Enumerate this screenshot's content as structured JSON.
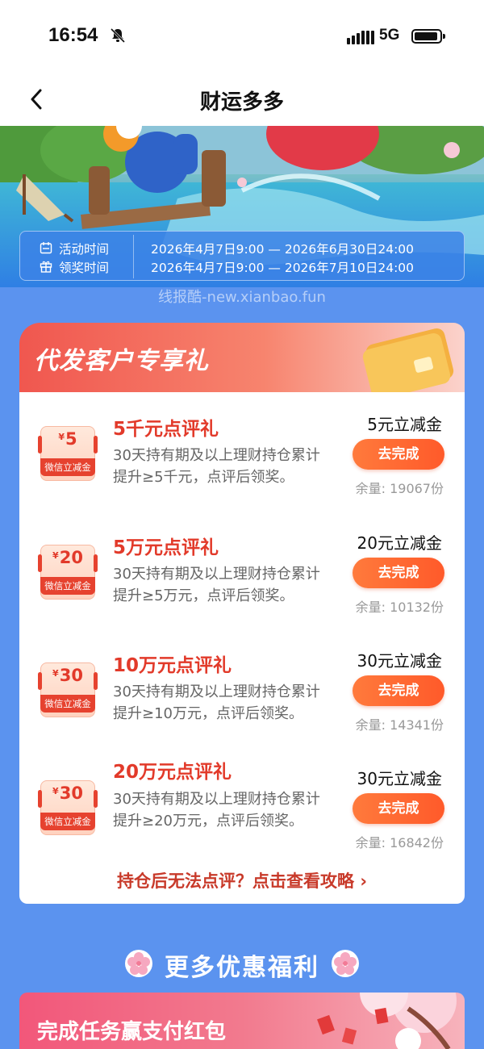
{
  "status_bar": {
    "time": "16:54",
    "network": "5G"
  },
  "nav": {
    "title": "财运多多"
  },
  "activity": {
    "activity_time_label": "活动时间",
    "activity_time_value": "2026年4月7日9:00 — 2026年6月30日24:00",
    "claim_time_label": "领奖时间",
    "claim_time_value": "2026年4月7日9:00 — 2026年7月10日24:00"
  },
  "watermark": "线报酷-new.xianbao.fun",
  "gift_section": {
    "title": "代发客户专享礼",
    "items": [
      {
        "coupon_symbol": "¥",
        "coupon_amount": "5",
        "coupon_label": "微信立减金",
        "title": "5千元点评礼",
        "desc": "30天持有期及以上理财持仓累计提升≥5千元，点评后领奖。",
        "reward": "5元立减金",
        "button": "去完成",
        "stock": "余量: 19067份"
      },
      {
        "coupon_symbol": "¥",
        "coupon_amount": "20",
        "coupon_label": "微信立减金",
        "title": "5万元点评礼",
        "desc": "30天持有期及以上理财持仓累计提升≥5万元，点评后领奖。",
        "reward": "20元立减金",
        "button": "去完成",
        "stock": "余量: 10132份"
      },
      {
        "coupon_symbol": "¥",
        "coupon_amount": "30",
        "coupon_label": "微信立减金",
        "title": "10万元点评礼",
        "desc": "30天持有期及以上理财持仓累计提升≥10万元，点评后领奖。",
        "reward": "30元立减金",
        "button": "去完成",
        "stock": "余量: 14341份"
      },
      {
        "coupon_symbol": "¥",
        "coupon_amount": "30",
        "coupon_label": "微信立减金",
        "title": "20万元点评礼",
        "desc": "30天持有期及以上理财持仓累计提升≥20万元，点评后领奖。",
        "reward": "30元立减金",
        "button": "去完成",
        "stock": "余量: 16842份"
      }
    ],
    "guide_link": "持仓后无法点评？点击查看攻略 ›"
  },
  "more_section": {
    "title": "更多优惠福利"
  },
  "task_banner": {
    "title": "完成任务赢支付红包"
  },
  "colors": {
    "page_bg": "#5b93ef",
    "accent_red": "#e23a2a",
    "button_orange": "#ff6a32"
  }
}
